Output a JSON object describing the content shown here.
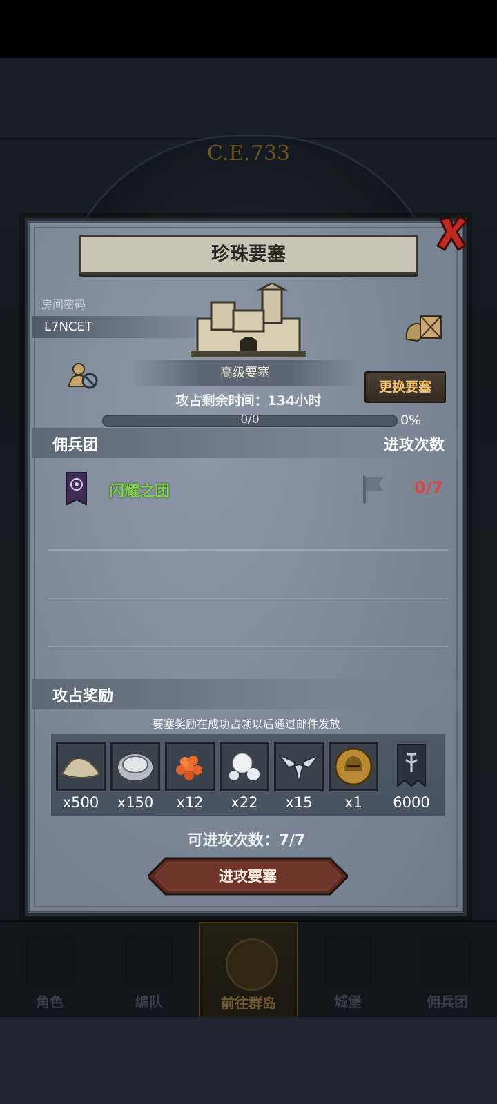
{
  "background": {
    "year": "C.E.733"
  },
  "dialog": {
    "title": "珍珠要塞",
    "room_code_label": "房间密码",
    "room_code": "L7NCET",
    "grade": "高级要塞",
    "change_button": "更换要塞",
    "time_left": "攻占剩余时间：134小时",
    "progress_text": "0/0",
    "progress_percent": "0%",
    "progress_value": 0,
    "mercenary_header": "佣兵团",
    "attack_count_header": "进攻次数",
    "mercenaries": [
      {
        "name": "闪耀之团",
        "attacks": "0/7"
      }
    ],
    "rewards_header": "攻占奖励",
    "rewards_note": "要塞奖励在成功占领以后通过邮件发放",
    "rewards": [
      {
        "icon": "sand-pile-icon",
        "qty": "x500"
      },
      {
        "icon": "oyster-icon",
        "qty": "x150"
      },
      {
        "icon": "fish-roe-icon",
        "qty": "x12"
      },
      {
        "icon": "pearls-icon",
        "qty": "x22"
      },
      {
        "icon": "winged-emblem-icon",
        "qty": "x15"
      },
      {
        "icon": "knight-helmet-coin-icon",
        "qty": "x1"
      },
      {
        "icon": "guild-banner-icon",
        "qty": "6000"
      }
    ],
    "attempts_left": "可进攻次数：7/7",
    "attack_button": "进攻要塞"
  },
  "nav": {
    "items": [
      {
        "label": "角色",
        "icon": "character-icon"
      },
      {
        "label": "编队",
        "icon": "formation-icon"
      },
      {
        "label": "前往群岛",
        "icon": "islands-icon"
      },
      {
        "label": "城堡",
        "icon": "castle-icon"
      },
      {
        "label": "佣兵团",
        "icon": "mercenary-icon"
      }
    ],
    "active": "前往群岛"
  },
  "colors": {
    "accent_gold": "#f0c36c",
    "merc_name_green": "#7fd04c",
    "attack_count_red": "#d94848",
    "dialog_bg": "#7e8a99"
  }
}
